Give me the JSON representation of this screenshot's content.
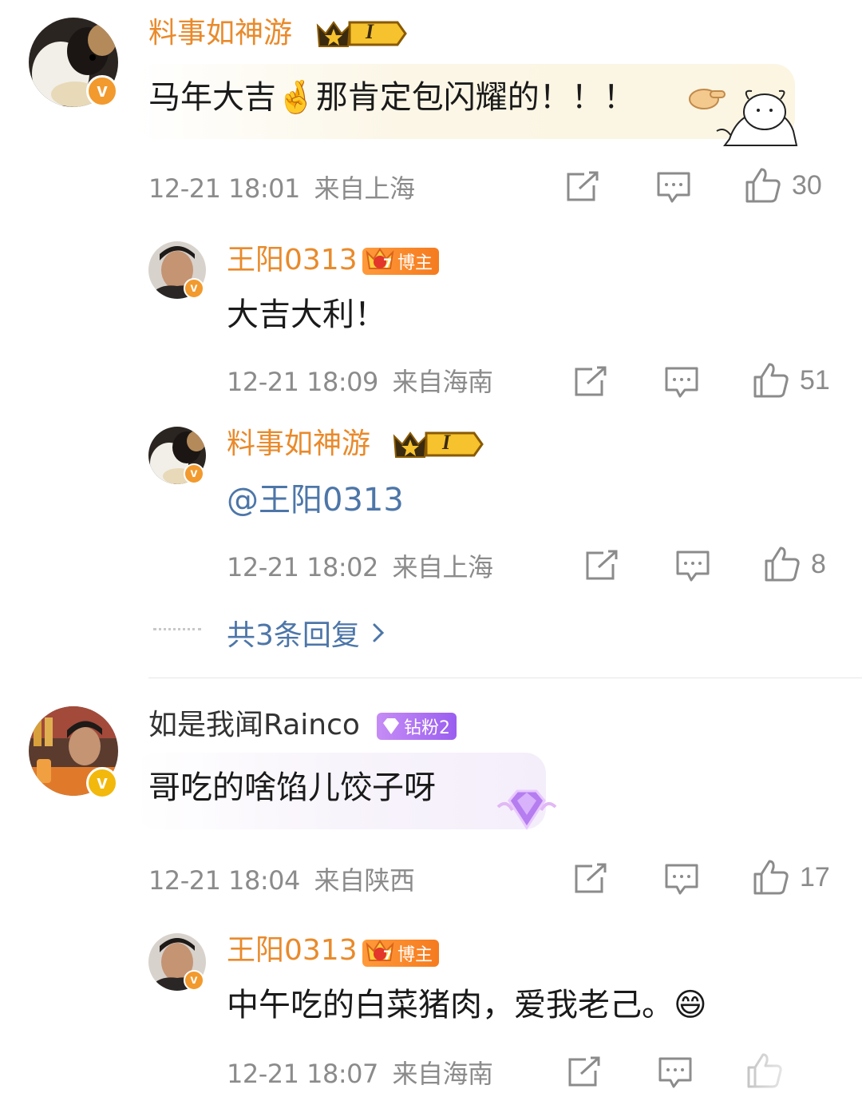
{
  "colors": {
    "username_orange": "#e98a2b",
    "link_blue": "#4d76a8",
    "meta_gray": "#8b8b8b",
    "bubble_cream": "#fbf7ea",
    "bubble_lilac": "#f6f2fb"
  },
  "comments": [
    {
      "username": "料事如神游",
      "badge": "I",
      "text": "马年大吉🤞那肯定包闪耀的！！！",
      "time": "12-21 18:01",
      "location": "来自上海",
      "likes": "30",
      "replies": [
        {
          "username": "王阳0313",
          "tag": "博主",
          "tag_level": "7",
          "text": "大吉大利！",
          "time": "12-21 18:09",
          "location": "来自海南",
          "likes": "51"
        },
        {
          "username": "料事如神游",
          "badge": "I",
          "text": "@王阳0313",
          "time": "12-21 18:02",
          "location": "来自上海",
          "likes": "8"
        }
      ],
      "more_replies": "共3条回复"
    },
    {
      "username": "如是我闻Rainco",
      "tag": "钻粉2",
      "text": "哥吃的啥馅儿饺子呀",
      "time": "12-21 18:04",
      "location": "来自陕西",
      "likes": "17",
      "replies": [
        {
          "username": "王阳0313",
          "tag": "博主",
          "tag_level": "7",
          "text": "中午吃的白菜猪肉，爱我老己。😄",
          "time": "12-21 18:07",
          "location": "来自海南"
        }
      ]
    }
  ],
  "icons": {
    "share": "share-icon",
    "comment": "comment-icon",
    "like": "like-icon",
    "verified": "verified-v-badge-icon",
    "more": "chevron-right-icon"
  },
  "v_letter": "v"
}
